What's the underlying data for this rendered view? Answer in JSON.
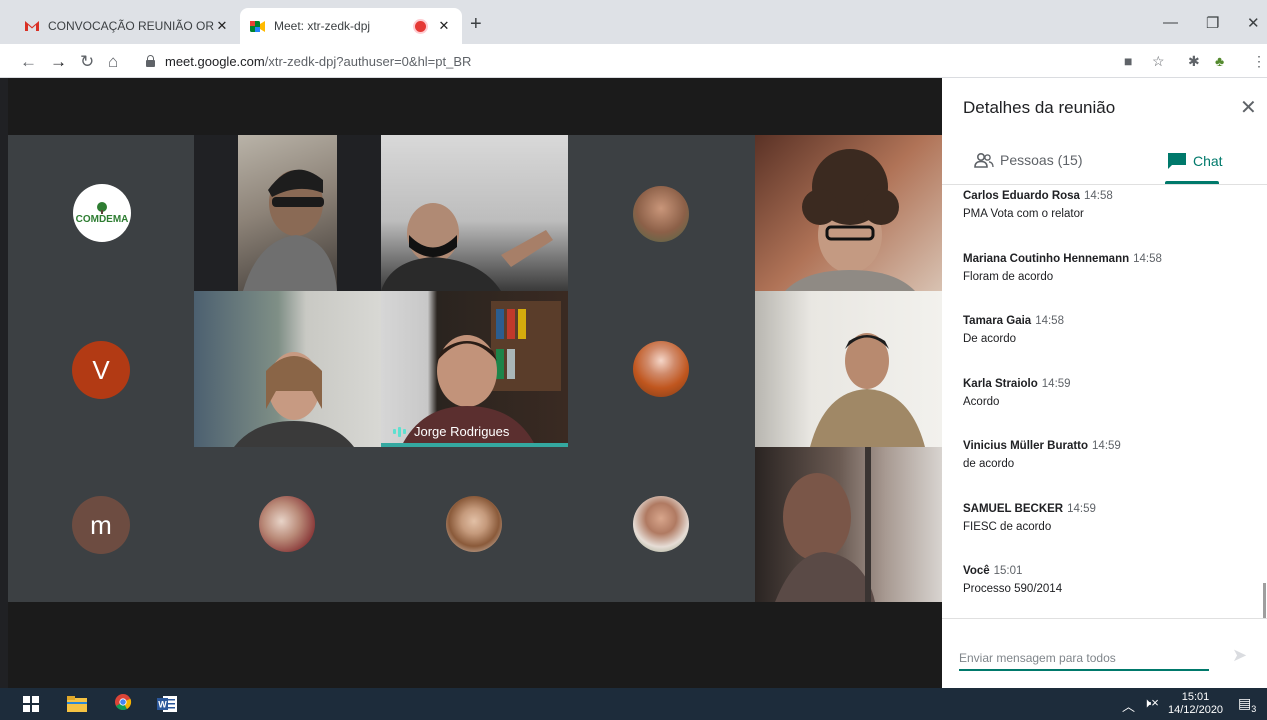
{
  "browser": {
    "tabs": [
      {
        "title": "CONVOCAÇÃO REUNIÃO ORDIN",
        "favicon": "gmail-icon"
      },
      {
        "title": "Meet: xtr-zedk-dpj",
        "favicon": "meet-icon",
        "recording": true
      }
    ],
    "url_host": "meet.google.com",
    "url_path": "/xtr-zedk-dpj?authuser=0&hl=pt_BR"
  },
  "meeting": {
    "active_speaker": "Jorge Rodrigues",
    "avatars": {
      "logo_text": "COMDEMA",
      "v_letter": "V",
      "m_letter": "m"
    },
    "colors": {
      "v": "#b23a14",
      "m": "#6d4c41",
      "speaking": "#34a8a0"
    }
  },
  "panel": {
    "title": "Detalhes da reunião",
    "tab_people": "Pessoas (15)",
    "tab_chat": "Chat",
    "messages": [
      {
        "sender": "Carlos Eduardo Rosa",
        "time": "14:58",
        "text": "PMA Vota com o relator"
      },
      {
        "sender": "Mariana Coutinho Hennemann",
        "time": "14:58",
        "text": "Floram de acordo"
      },
      {
        "sender": "Tamara Gaia",
        "time": "14:58",
        "text": "De acordo"
      },
      {
        "sender": "Karla Straiolo",
        "time": "14:59",
        "text": "Acordo"
      },
      {
        "sender": "Vinicius Müller Buratto",
        "time": "14:59",
        "text": "de acordo"
      },
      {
        "sender": "SAMUEL BECKER",
        "time": "14:59",
        "text": "FIESC de acordo"
      },
      {
        "sender": "Você",
        "time": "15:01",
        "text": "Processo 590/2014"
      }
    ],
    "input_placeholder": "Enviar mensagem para todos"
  },
  "taskbar": {
    "time": "15:01",
    "date": "14/12/2020",
    "notifications": "3"
  }
}
